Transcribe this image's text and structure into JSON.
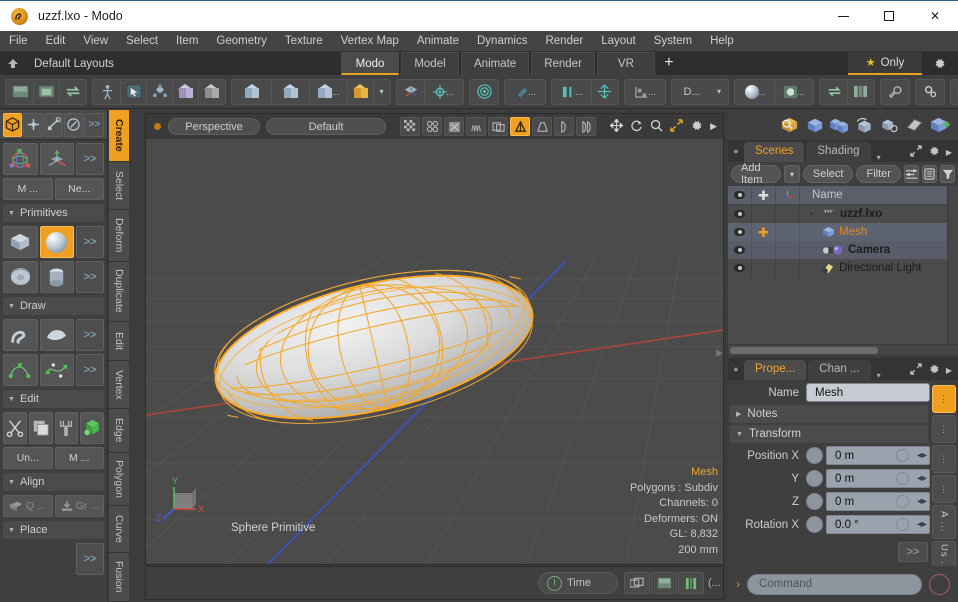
{
  "window": {
    "title": "uzzf.lxo - Modo",
    "app_icon": "modo-logo-icon",
    "minimize": "—",
    "maximize": "□",
    "close": "✕"
  },
  "menubar": {
    "items": [
      "File",
      "Edit",
      "View",
      "Select",
      "Item",
      "Geometry",
      "Texture",
      "Vertex Map",
      "Animate",
      "Dynamics",
      "Render",
      "Layout",
      "System",
      "Help"
    ]
  },
  "layoutbar": {
    "home_icon": "home-up-icon",
    "name": "Default Layouts",
    "tabs": [
      {
        "label": "Modo",
        "active": true
      },
      {
        "label": "Model",
        "active": false
      },
      {
        "label": "Animate",
        "active": false
      },
      {
        "label": "Render",
        "active": false
      },
      {
        "label": "VR",
        "active": false
      }
    ],
    "add_tab": "+",
    "only_label": "Only",
    "star_icon": "star-icon",
    "gear_icon": "gear-icon"
  },
  "toolbar": {
    "groups": [
      {
        "buttons": [
          {
            "icon": "layout-split-horizontal-icon"
          },
          {
            "icon": "layout-split-vertical-icon"
          },
          {
            "icon": "swap-views-icon"
          }
        ]
      },
      {
        "buttons": [
          {
            "icon": "figure-scale-icon"
          },
          {
            "icon": "select-arrow-icon"
          },
          {
            "icon": "element-move-icon"
          },
          {
            "icon": "cube-purple-icon"
          },
          {
            "icon": "cube-grey-icon"
          }
        ]
      },
      {
        "buttons": [
          {
            "icon": "cube-vertex-icon"
          },
          {
            "icon": "cube-edge-icon"
          },
          {
            "icon": "cube-polygon-icon",
            "dots": "..."
          },
          {
            "icon": "cube-item-gold-icon"
          },
          {
            "icon": "mode-caret-icon"
          }
        ]
      },
      {
        "buttons": [
          {
            "icon": "gizmo-axis-icon"
          },
          {
            "icon": "center-target-icon",
            "dots": "..."
          }
        ]
      },
      {
        "buttons": [
          {
            "icon": "falloff-radial-icon"
          }
        ]
      },
      {
        "buttons": [
          {
            "icon": "snap-magnet-icon",
            "dots": "..."
          }
        ]
      },
      {
        "buttons": [
          {
            "icon": "symmetry-icon",
            "dots": "..."
          },
          {
            "icon": "action-center-icon"
          }
        ]
      },
      {
        "buttons": [
          {
            "icon": "workplane-icon",
            "dots": "..."
          }
        ]
      },
      {
        "buttons": [
          {
            "icon": "dropdown-d-icon",
            "label": "D...",
            "caret": "▾"
          }
        ]
      },
      {
        "buttons": [
          {
            "icon": "material-sphere-icon",
            "dots": "..."
          },
          {
            "icon": "shader-preview-icon",
            "dots": "..."
          }
        ]
      },
      {
        "buttons": [
          {
            "icon": "swap-icon"
          },
          {
            "icon": "columns-icon"
          }
        ]
      },
      {
        "buttons": [
          {
            "icon": "wrench-icon"
          }
        ]
      },
      {
        "buttons": [
          {
            "icon": "gears-icon"
          }
        ]
      },
      {
        "buttons": [
          {
            "icon": "panel-icon"
          }
        ]
      }
    ]
  },
  "left_panel": {
    "mode_buttons": [
      {
        "icon": "item-mode-cube-icon",
        "active": true
      },
      {
        "icon": "vertex-mode-icon",
        "active": false
      },
      {
        "icon": "polygon-mode-icon",
        "active": false
      },
      {
        "icon": "paint-mode-icon",
        "active": false
      },
      {
        "icon": "more-arrows-icon",
        "label": ">>"
      }
    ],
    "transform_row": [
      {
        "icon": "rotate-gizmo-icon"
      },
      {
        "icon": "move-gizmo-icon"
      },
      {
        "label": ">>"
      }
    ],
    "transform_text_row": [
      {
        "label": "M ..."
      },
      {
        "label": "Ne..."
      }
    ],
    "sections": [
      {
        "title": "Primitives",
        "rows": [
          [
            {
              "icon": "cube-primitive-icon",
              "active": false
            },
            {
              "icon": "sphere-primitive-icon",
              "active": true
            },
            {
              "label": ">>"
            }
          ],
          [
            {
              "icon": "torus-primitive-icon",
              "active": false
            },
            {
              "icon": "cylinder-primitive-icon",
              "active": false
            },
            {
              "label": ">>"
            }
          ]
        ]
      },
      {
        "title": "Draw",
        "rows": [
          [
            {
              "icon": "pen-draw-icon"
            },
            {
              "icon": "sketch-patch-icon"
            },
            {
              "label": ">>"
            }
          ],
          [
            {
              "icon": "curve-icon"
            },
            {
              "icon": "bezier-curve-icon"
            },
            {
              "label": ">>"
            }
          ]
        ]
      },
      {
        "title": "Edit",
        "rows": [
          [
            {
              "icon": "scissors-icon"
            },
            {
              "icon": "copy-icon"
            },
            {
              "icon": "paste-brush-icon"
            },
            {
              "icon": "merge-green-icon"
            }
          ]
        ],
        "text_rows": [
          [
            {
              "label": "Un..."
            },
            {
              "label": "M ..."
            }
          ]
        ]
      },
      {
        "title": "Align",
        "text_rows": [
          [
            {
              "label": "Q ...",
              "icon": "quick-align-icon",
              "dim": true
            },
            {
              "label": "Gr ...",
              "icon": "ground-icon",
              "dim": true
            }
          ]
        ]
      },
      {
        "title": "Place",
        "rows": [
          [
            {
              "label": ">>"
            }
          ]
        ]
      }
    ],
    "vertical_tabs": [
      {
        "label": "Create",
        "active": true
      },
      {
        "label": "Select",
        "active": false
      },
      {
        "label": "Deform",
        "active": false
      },
      {
        "label": "Duplicate",
        "active": false
      },
      {
        "label": "Edit",
        "active": false
      },
      {
        "label": "Vertex",
        "active": false
      },
      {
        "label": "Edge",
        "active": false
      },
      {
        "label": "Polygon",
        "active": false
      },
      {
        "label": "Curve",
        "active": false
      },
      {
        "label": "Fusion",
        "active": false
      }
    ]
  },
  "viewport": {
    "view_name": "Perspective",
    "shading_name": "Default",
    "status_dot_color": "#c07a14",
    "display_icons": [
      {
        "icon": "checker-pattern-icon",
        "active": false
      },
      {
        "icon": "dots-grid-icon",
        "active": false
      },
      {
        "icon": "shade-box-icon",
        "active": false
      },
      {
        "icon": "wire-lines-icon",
        "active": false
      },
      {
        "icon": "texture-decal-icon",
        "active": false
      },
      {
        "icon": "light-triangle-icon",
        "active": true
      },
      {
        "icon": "camera-frustum-icon",
        "active": false
      },
      {
        "icon": "backdrop-icon",
        "active": false
      },
      {
        "icon": "pages-icon",
        "active": false
      }
    ],
    "nav_icons": [
      {
        "icon": "pan-move-icon"
      },
      {
        "icon": "rotate-orbit-icon"
      },
      {
        "icon": "zoom-magnifier-icon"
      },
      {
        "icon": "fit-expand-icon"
      },
      {
        "icon": "gear-icon"
      },
      {
        "icon": "play-arrow-icon"
      }
    ],
    "object_label": "Sphere Primitive",
    "axis_gizmo": {
      "x": "X",
      "y": "Y",
      "z": "Z"
    },
    "info": {
      "name": "Mesh",
      "lines": [
        "Polygons : Subdiv",
        "Channels: 0",
        "Deformers: ON",
        "GL: 8,832",
        "200 mm"
      ]
    },
    "colors": {
      "background": "#4b4b4b",
      "mesh_wire": "#f5a623",
      "axis_x": "#a84a3c",
      "axis_z": "#3b58c4"
    },
    "bottom_bar": {
      "time_label": "Time",
      "clock_icon": "clock-icon",
      "buttons": [
        {
          "icon": "copy-windows-icon"
        },
        {
          "icon": "layout-panel-icon"
        },
        {
          "icon": "mirror-green-icon"
        }
      ],
      "overflow": "(..."
    }
  },
  "right_panel": {
    "tool_icons": [
      {
        "icon": "mesh-inspect-icon"
      },
      {
        "icon": "cube-blue-icon"
      },
      {
        "icon": "cubes-duplicate-icon"
      },
      {
        "icon": "cube-link-icon"
      },
      {
        "icon": "cube-settings-icon"
      },
      {
        "icon": "plane-shape-icon"
      },
      {
        "icon": "cube-export-icon"
      }
    ],
    "tabs": [
      {
        "label": "Scenes",
        "active": true
      },
      {
        "label": "Shading",
        "active": false
      }
    ],
    "tab_caret": "▾",
    "tab_icons": [
      {
        "icon": "expand-panel-icon"
      },
      {
        "icon": "gear-icon"
      },
      {
        "icon": "play-arrow-icon"
      }
    ],
    "commands": [
      {
        "label": "Add Item",
        "type": "button"
      },
      {
        "label": "▾",
        "type": "caret"
      },
      {
        "label": "Select",
        "type": "button"
      },
      {
        "label": "Filter",
        "type": "button"
      },
      {
        "icon": "list-sort-icon",
        "type": "icon"
      },
      {
        "icon": "list-view-icon",
        "type": "icon"
      },
      {
        "icon": "funnel-filter-icon",
        "type": "icon"
      }
    ],
    "list_columns": [
      {
        "icon": "eye-icon"
      },
      {
        "icon": "plus-lock-icon"
      },
      {
        "icon": "axis-gizmo-icon"
      },
      {
        "label": "Name"
      }
    ],
    "items": [
      {
        "name": "uzzf.lxo",
        "icon": "clapperboard-icon",
        "indent": 0,
        "selected": false,
        "expanded": true,
        "visible": true,
        "locked": false
      },
      {
        "name": "Mesh",
        "icon": "cube-blue-icon",
        "indent": 1,
        "selected": true,
        "visible": true,
        "locked": true,
        "highlight": "orange"
      },
      {
        "name": "Camera",
        "icon": "camera-icon",
        "indent": 1,
        "selected": true,
        "visible": true,
        "locked": false
      },
      {
        "name": "Directional Light",
        "icon": "light-icon",
        "indent": 1,
        "selected": false,
        "visible": true,
        "locked": false
      }
    ]
  },
  "properties": {
    "tabs": [
      {
        "label": "Prope...",
        "active": true
      },
      {
        "label": "Chan ...",
        "active": false
      }
    ],
    "tab_caret": "▾",
    "name_label": "Name",
    "name_value": "Mesh",
    "sections": [
      {
        "label": "Notes",
        "expanded": false
      },
      {
        "label": "Transform",
        "expanded": true
      }
    ],
    "fields": [
      {
        "label": "Position X",
        "value": "0 m"
      },
      {
        "label": "Y",
        "value": "0 m"
      },
      {
        "label": "Z",
        "value": "0 m"
      },
      {
        "label": "Rotation X",
        "value": "0.0 °"
      }
    ],
    "more_button": ">>",
    "vertical_tabs": [
      {
        "label": "⋮",
        "active": true
      },
      {
        "label": "⋮",
        "active": false
      },
      {
        "label": "⋮",
        "active": false
      },
      {
        "label": "⋮",
        "active": false
      },
      {
        "label": "A ...",
        "active": false
      },
      {
        "label": "Us ...",
        "active": false
      }
    ]
  },
  "command_bar": {
    "prompt": "›",
    "placeholder": "Command",
    "record_icon": "record-circle-icon"
  }
}
